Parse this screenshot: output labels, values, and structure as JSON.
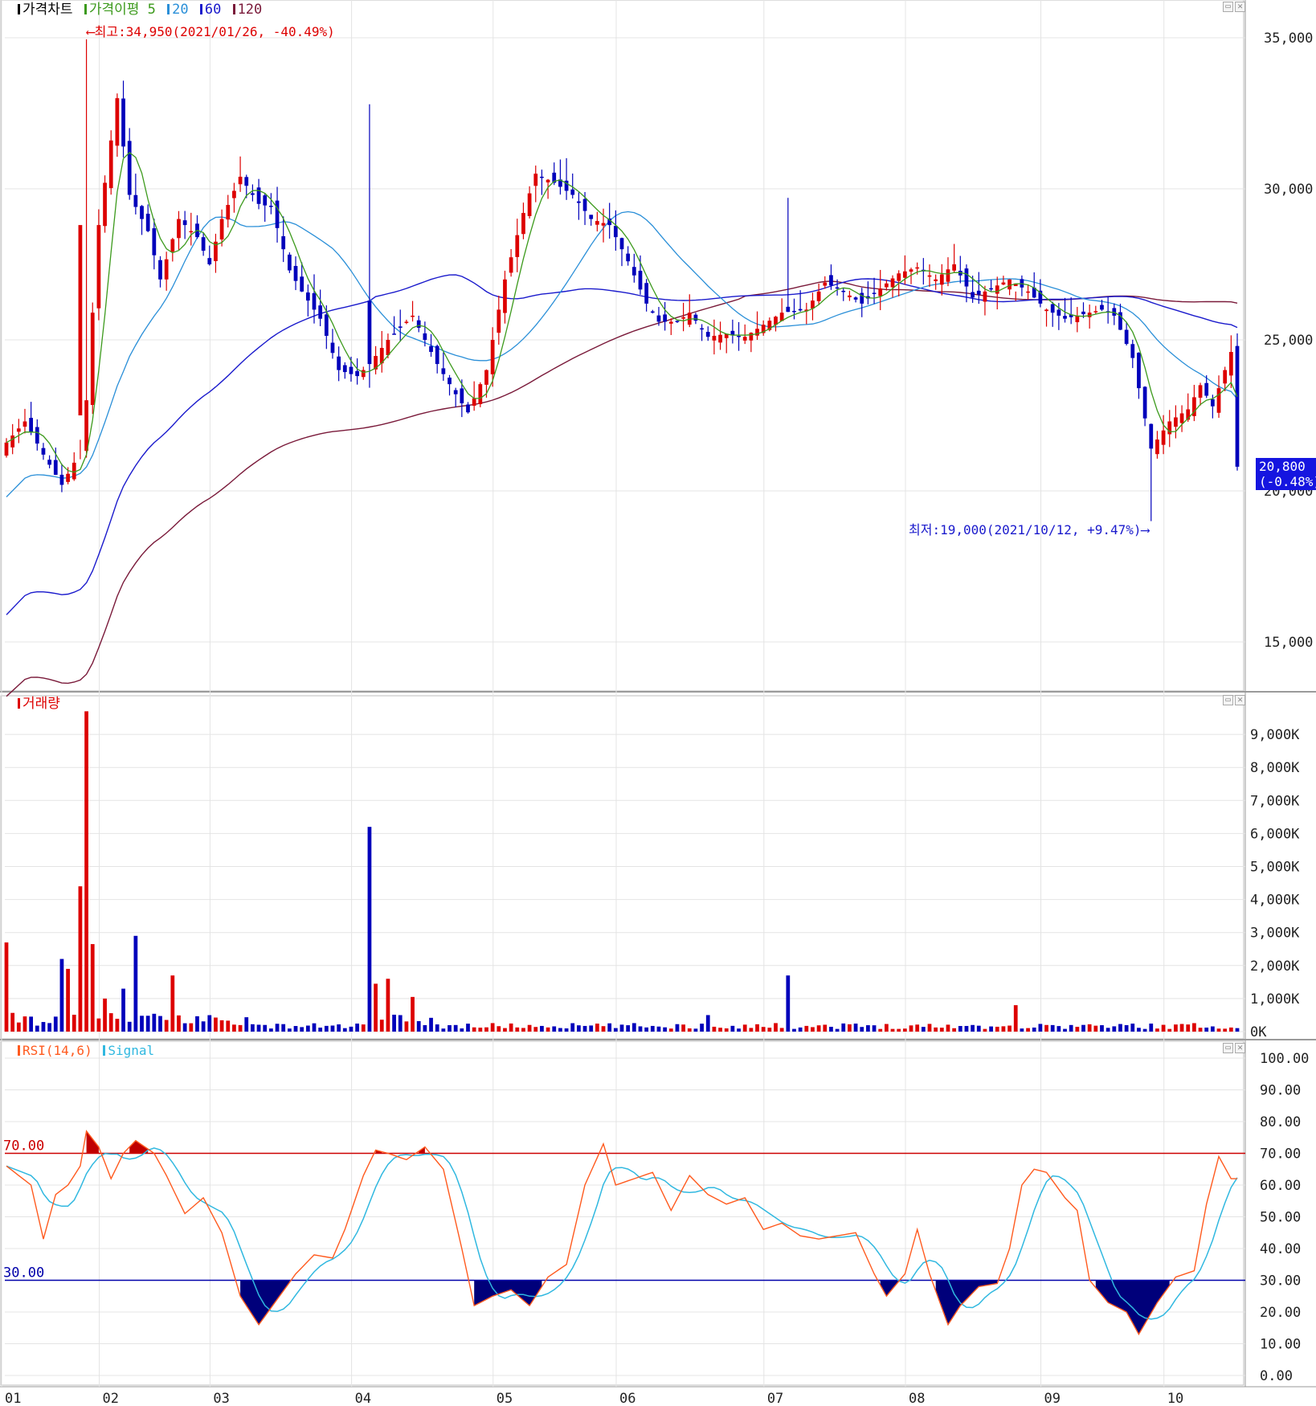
{
  "chart_data": [
    {
      "type": "candlestick",
      "title": "가격차트",
      "legend": [
        {
          "label": "가격차트",
          "color": "#000000"
        },
        {
          "label": "가격이평 5",
          "color": "#3c9a1c"
        },
        {
          "label": "20",
          "color": "#2a8fd8"
        },
        {
          "label": "60",
          "color": "#1a1acc"
        },
        {
          "label": "120",
          "color": "#7a1a3a"
        }
      ],
      "x_tick_labels": [
        "01",
        "02",
        "03",
        "04",
        "05",
        "06",
        "07",
        "08",
        "09",
        "10"
      ],
      "y_tick_labels": [
        "35,000",
        "30,000",
        "25,000",
        "20,000",
        "15,000"
      ],
      "ylim": [
        13400,
        36200
      ],
      "yticks": [
        35000,
        30000,
        25000,
        20000,
        15000
      ],
      "days": 201,
      "close_anchors": [
        [
          0,
          21600
        ],
        [
          3,
          22300
        ],
        [
          6,
          21200
        ],
        [
          9,
          20200
        ],
        [
          12,
          21300
        ],
        [
          13,
          23000
        ],
        [
          15,
          28800
        ],
        [
          18,
          33000
        ],
        [
          20,
          29800
        ],
        [
          23,
          28600
        ],
        [
          25,
          27000
        ],
        [
          28,
          29000
        ],
        [
          31,
          28400
        ],
        [
          33,
          27500
        ],
        [
          35,
          29000
        ],
        [
          38,
          30400
        ],
        [
          41,
          29500
        ],
        [
          43,
          29400
        ],
        [
          46,
          27300
        ],
        [
          48,
          26600
        ],
        [
          51,
          25700
        ],
        [
          54,
          24000
        ],
        [
          57,
          23800
        ],
        [
          59,
          24200
        ],
        [
          62,
          25000
        ],
        [
          66,
          25800
        ],
        [
          70,
          24200
        ],
        [
          73,
          23200
        ],
        [
          75,
          22600
        ],
        [
          78,
          24000
        ],
        [
          81,
          27000
        ],
        [
          84,
          29200
        ],
        [
          86,
          30500
        ],
        [
          89,
          30200
        ],
        [
          92,
          29800
        ],
        [
          95,
          29000
        ],
        [
          98,
          28800
        ],
        [
          101,
          27600
        ],
        [
          104,
          26200
        ],
        [
          106,
          25600
        ],
        [
          109,
          25600
        ],
        [
          111,
          25900
        ],
        [
          114,
          25100
        ],
        [
          117,
          25200
        ],
        [
          120,
          25100
        ],
        [
          123,
          25500
        ],
        [
          126,
          25900
        ],
        [
          130,
          26000
        ],
        [
          133,
          26900
        ],
        [
          136,
          26600
        ],
        [
          139,
          26200
        ],
        [
          142,
          26700
        ],
        [
          145,
          27200
        ],
        [
          148,
          27400
        ],
        [
          151,
          27000
        ],
        [
          154,
          27500
        ],
        [
          157,
          26400
        ],
        [
          160,
          26700
        ],
        [
          163,
          27000
        ],
        [
          166,
          26600
        ],
        [
          169,
          26000
        ],
        [
          172,
          25700
        ],
        [
          174,
          25800
        ],
        [
          176,
          25900
        ],
        [
          178,
          26000
        ],
        [
          180,
          25800
        ],
        [
          183,
          24400
        ],
        [
          186,
          21400
        ],
        [
          189,
          22300
        ],
        [
          192,
          22700
        ],
        [
          194,
          23500
        ],
        [
          196,
          22800
        ],
        [
          199,
          24600
        ],
        [
          200,
          20800
        ]
      ],
      "close_anchors_note": "day index vs closing price; remaining daily bars interpolated",
      "volume": {
        "title": "거래량",
        "y_tick_labels": [
          "9,000K",
          "8,000K",
          "7,000K",
          "6,000K",
          "5,000K",
          "4,000K",
          "3,000K",
          "2,000K",
          "1,000K",
          "0K"
        ],
        "ylim": [
          0,
          9800
        ],
        "spikes": [
          [
            0,
            2700
          ],
          [
            9,
            2200
          ],
          [
            10,
            1900
          ],
          [
            12,
            4400
          ],
          [
            13,
            9700
          ],
          [
            14,
            2650
          ],
          [
            16,
            1000
          ],
          [
            19,
            1300
          ],
          [
            21,
            2900
          ],
          [
            27,
            1700
          ],
          [
            59,
            6200
          ],
          [
            60,
            1450
          ],
          [
            62,
            1600
          ],
          [
            66,
            1050
          ],
          [
            114,
            500
          ],
          [
            127,
            1700
          ],
          [
            164,
            800
          ]
        ],
        "base_level": 200
      },
      "rsi": {
        "title": "RSI(14,6)",
        "signal_label": "Signal",
        "y_tick_labels": [
          "100.00",
          "90.00",
          "80.00",
          "70.00",
          "60.00",
          "50.00",
          "40.00",
          "30.00",
          "20.00",
          "10.00",
          "0.00"
        ],
        "ylim": [
          0,
          100
        ],
        "upper_level": 70,
        "lower_level": 30,
        "upper_label": "70.00",
        "lower_label": "30.00",
        "anchors": [
          [
            0,
            66
          ],
          [
            4,
            60
          ],
          [
            6,
            43
          ],
          [
            8,
            57
          ],
          [
            10,
            60
          ],
          [
            12,
            66
          ],
          [
            13,
            77
          ],
          [
            15,
            72
          ],
          [
            17,
            62
          ],
          [
            19,
            70
          ],
          [
            21,
            74
          ],
          [
            24,
            70
          ],
          [
            26,
            63
          ],
          [
            29,
            51
          ],
          [
            32,
            56
          ],
          [
            35,
            45
          ],
          [
            38,
            25
          ],
          [
            41,
            16
          ],
          [
            44,
            24
          ],
          [
            47,
            32
          ],
          [
            50,
            38
          ],
          [
            53,
            37
          ],
          [
            55,
            46
          ],
          [
            58,
            63
          ],
          [
            60,
            71
          ],
          [
            62,
            70
          ],
          [
            65,
            68
          ],
          [
            68,
            72
          ],
          [
            71,
            65
          ],
          [
            74,
            40
          ],
          [
            76,
            22
          ],
          [
            79,
            25
          ],
          [
            82,
            27
          ],
          [
            85,
            22
          ],
          [
            88,
            31
          ],
          [
            91,
            35
          ],
          [
            94,
            60
          ],
          [
            97,
            73
          ],
          [
            99,
            60
          ],
          [
            102,
            62
          ],
          [
            105,
            64
          ],
          [
            108,
            52
          ],
          [
            111,
            63
          ],
          [
            114,
            57
          ],
          [
            117,
            54
          ],
          [
            120,
            56
          ],
          [
            123,
            46
          ],
          [
            126,
            48
          ],
          [
            129,
            44
          ],
          [
            132,
            43
          ],
          [
            135,
            44
          ],
          [
            138,
            45
          ],
          [
            141,
            32
          ],
          [
            143,
            25
          ],
          [
            146,
            32
          ],
          [
            148,
            46
          ],
          [
            150,
            32
          ],
          [
            153,
            16
          ],
          [
            155,
            22
          ],
          [
            158,
            28
          ],
          [
            161,
            29
          ],
          [
            163,
            40
          ],
          [
            165,
            60
          ],
          [
            167,
            65
          ],
          [
            169,
            64
          ],
          [
            172,
            56
          ],
          [
            174,
            52
          ],
          [
            176,
            30
          ],
          [
            179,
            23
          ],
          [
            182,
            20
          ],
          [
            184,
            13
          ],
          [
            187,
            23
          ],
          [
            190,
            31
          ],
          [
            193,
            33
          ],
          [
            195,
            54
          ],
          [
            197,
            69
          ],
          [
            199,
            62
          ]
        ]
      },
      "annotations": {
        "high": "최고:34,950(2021/01/26, -40.49%)",
        "low": "최저:19,000(2021/10/12, +9.47%)"
      },
      "current_price": "20,800",
      "current_change": "(-0.48%)",
      "grid": true,
      "legend_placement": "top-left"
    }
  ],
  "colors": {
    "up": "#dd0000",
    "down": "#0000bb",
    "ma5": "#3c9a1c",
    "ma20": "#2a8fd8",
    "ma60": "#1a1acc",
    "ma120": "#7a1a3a",
    "rsi": "#ff5a1e",
    "signal": "#30b8e0",
    "upper_line": "#cc0000",
    "lower_line": "#0000aa",
    "grid": "#e4e4e4"
  },
  "window_buttons": [
    "▭",
    "✕"
  ]
}
